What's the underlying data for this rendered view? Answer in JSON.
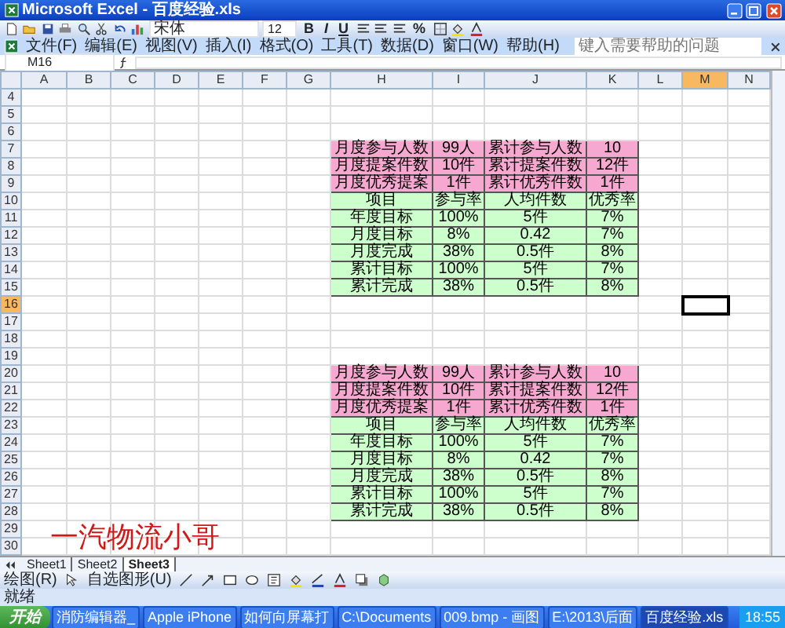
{
  "window": {
    "title": "Microsoft Excel - 百度经验.xls"
  },
  "toolbar": {
    "font": "宋体",
    "size": "12",
    "format_buttons": [
      "B",
      "I",
      "U"
    ],
    "percent": "%"
  },
  "menu": [
    "文件(F)",
    "编辑(E)",
    "视图(V)",
    "插入(I)",
    "格式(O)",
    "工具(T)",
    "数据(D)",
    "窗口(W)",
    "帮助(H)"
  ],
  "help_box": {
    "placeholder": "键入需要帮助的问题"
  },
  "name_box": "M16",
  "columns": [
    {
      "letter": "A",
      "selected": false
    },
    {
      "letter": "B",
      "selected": false
    },
    {
      "letter": "C",
      "selected": false
    },
    {
      "letter": "D",
      "selected": false
    },
    {
      "letter": "E",
      "selected": false
    },
    {
      "letter": "F",
      "selected": false
    },
    {
      "letter": "G",
      "selected": false
    },
    {
      "letter": "H",
      "selected": false
    },
    {
      "letter": "I",
      "selected": false
    },
    {
      "letter": "J",
      "selected": false
    },
    {
      "letter": "K",
      "selected": false
    },
    {
      "letter": "L",
      "selected": false
    },
    {
      "letter": "M",
      "selected": true
    },
    {
      "letter": "N",
      "selected": false
    }
  ],
  "grid_rows": [
    {
      "number": "4",
      "selected": false
    },
    {
      "number": "5",
      "selected": false
    },
    {
      "number": "6",
      "selected": false
    },
    {
      "number": "7",
      "selected": false,
      "color": "#f7a8d0",
      "cells": [
        "月度参与人数",
        "99人",
        "累计参与人数",
        "10"
      ]
    },
    {
      "number": "8",
      "selected": false,
      "color": "#f7a8d0",
      "cells": [
        "月度提案件数",
        "10件",
        "累计提案件数",
        "12件"
      ]
    },
    {
      "number": "9",
      "selected": false,
      "color": "#f7a8d0",
      "cells": [
        "月度优秀提案",
        "1件",
        "累计优秀件数",
        "1件"
      ]
    },
    {
      "number": "10",
      "selected": false,
      "color": "#ccffcc",
      "cells": [
        "项目",
        "参与率",
        "人均件数",
        "优秀率"
      ]
    },
    {
      "number": "11",
      "selected": false,
      "color": "#ccffcc",
      "cells": [
        "年度目标",
        "100%",
        "5件",
        "7%"
      ]
    },
    {
      "number": "12",
      "selected": false,
      "color": "#ccffcc",
      "cells": [
        "月度目标",
        "8%",
        "0.42",
        "7%"
      ]
    },
    {
      "number": "13",
      "selected": false,
      "color": "#ccffcc",
      "cells": [
        "月度完成",
        "38%",
        "0.5件",
        "8%"
      ]
    },
    {
      "number": "14",
      "selected": false,
      "color": "#ccffcc",
      "cells": [
        "累计目标",
        "100%",
        "5件",
        "7%"
      ]
    },
    {
      "number": "15",
      "selected": false,
      "color": "#ccffcc",
      "cells": [
        "累计完成",
        "38%",
        "0.5件",
        "8%"
      ]
    },
    {
      "number": "16",
      "selected": true
    },
    {
      "number": "17",
      "selected": false
    },
    {
      "number": "18",
      "selected": false
    },
    {
      "number": "19",
      "selected": false
    },
    {
      "number": "20",
      "selected": false,
      "color": "#f7a8d0",
      "cells": [
        "月度参与人数",
        "99人",
        "累计参与人数",
        "10"
      ]
    },
    {
      "number": "21",
      "selected": false,
      "color": "#f7a8d0",
      "cells": [
        "月度提案件数",
        "10件",
        "累计提案件数",
        "12件"
      ]
    },
    {
      "number": "22",
      "selected": false,
      "color": "#f7a8d0",
      "cells": [
        "月度优秀提案",
        "1件",
        "累计优秀件数",
        "1件"
      ]
    },
    {
      "number": "23",
      "selected": false,
      "color": "#ccffcc",
      "cells": [
        "项目",
        "参与率",
        "人均件数",
        "优秀率"
      ]
    },
    {
      "number": "24",
      "selected": false,
      "color": "#ccffcc",
      "cells": [
        "年度目标",
        "100%",
        "5件",
        "7%"
      ]
    },
    {
      "number": "25",
      "selected": false,
      "color": "#ccffcc",
      "cells": [
        "月度目标",
        "8%",
        "0.42",
        "7%"
      ]
    },
    {
      "number": "26",
      "selected": false,
      "color": "#ccffcc",
      "cells": [
        "月度完成",
        "38%",
        "0.5件",
        "8%"
      ]
    },
    {
      "number": "27",
      "selected": false,
      "color": "#ccffcc",
      "cells": [
        "累计目标",
        "100%",
        "5件",
        "7%"
      ]
    },
    {
      "number": "28",
      "selected": false,
      "color": "#ccffcc",
      "cells": [
        "累计完成",
        "38%",
        "0.5件",
        "8%"
      ]
    },
    {
      "number": "29",
      "selected": false
    },
    {
      "number": "30",
      "selected": false
    }
  ],
  "signature": "一汽物流小哥",
  "sheet_tabs": [
    {
      "label": "Sheet1",
      "selected": false
    },
    {
      "label": "Sheet2",
      "selected": false
    },
    {
      "label": "Sheet3",
      "selected": true
    }
  ],
  "drawing_toolbar": [
    "绘图(R)",
    "自选图形(U)"
  ],
  "status_bar": "就绪",
  "taskbar": {
    "start": "开始",
    "items": [
      {
        "label": "消防编辑器_",
        "selected": false
      },
      {
        "label": "Apple iPhone",
        "selected": false
      },
      {
        "label": "如何向屏幕打",
        "selected": false
      },
      {
        "label": "C:\\Documents",
        "selected": false
      },
      {
        "label": "009.bmp - 画图",
        "selected": false
      },
      {
        "label": "E:\\2013\\后面",
        "selected": false
      },
      {
        "label": "百度经验.xls",
        "selected": true
      }
    ],
    "clock": "18:55"
  }
}
